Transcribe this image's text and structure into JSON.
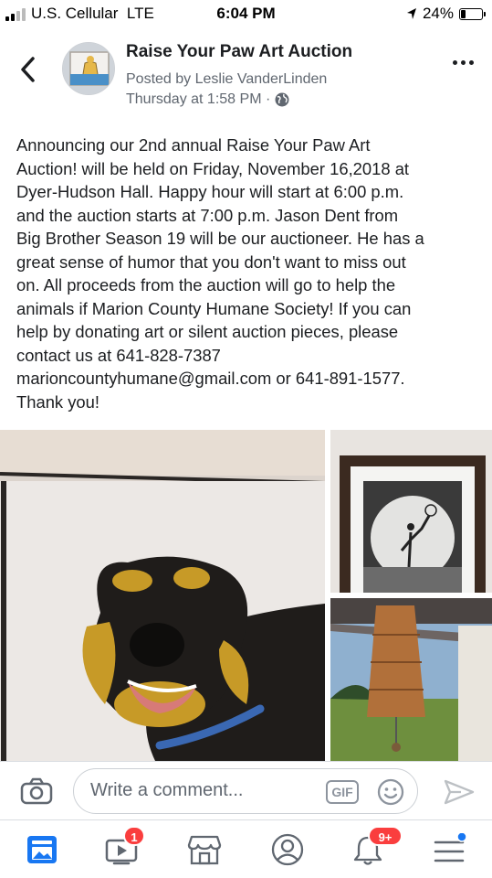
{
  "status_bar": {
    "carrier": "U.S. Cellular",
    "network": "LTE",
    "time": "6:04 PM",
    "battery_percent": "24%",
    "battery_level": 0.24
  },
  "header": {
    "title": "Raise Your Paw Art Auction",
    "author": "Posted by Leslie VanderLinden",
    "timestamp": "Thursday at 1:58 PM ·",
    "back_icon": "chevron-left-icon",
    "more_icon": "more-horizontal-icon",
    "privacy_icon": "globe-icon"
  },
  "post": {
    "lines": [
      "Announcing our 2nd annual Raise Your Paw Art",
      "Auction! will be held on Friday, November 16,2018 at",
      "Dyer-Hudson Hall. Happy hour will start at 6:00 p.m.",
      "and the auction starts at 7:00 p.m.  Jason Dent from",
      "Big Brother Season 19 will be our auctioneer. He has a",
      "great sense of humor that you don't want to miss out",
      "on.  All proceeds from the auction will go to help the",
      "animals if Marion County Humane Society!  If you can",
      "help by donating art or silent auction pieces, please",
      "contact us at 641-828-7387",
      "marioncountyhumane@gmail.com or 641-891-1577.",
      "Thank you!"
    ]
  },
  "composer": {
    "placeholder": "Write a comment...",
    "gif_label": "GIF",
    "camera_icon": "camera-icon",
    "emoji_icon": "emoji-icon",
    "send_icon": "send-icon"
  },
  "bottom_nav": {
    "items": [
      {
        "icon": "news-feed-icon",
        "badge": ""
      },
      {
        "icon": "watch-icon",
        "badge": "1"
      },
      {
        "icon": "marketplace-icon",
        "badge": ""
      },
      {
        "icon": "profile-icon",
        "badge": ""
      },
      {
        "icon": "notifications-icon",
        "badge": "9+"
      },
      {
        "icon": "menu-icon",
        "badge": ""
      }
    ]
  },
  "colors": {
    "accent": "#1877f2",
    "badge": "#fa3e3e",
    "text_primary": "#1c1e21",
    "text_secondary": "#606770"
  }
}
